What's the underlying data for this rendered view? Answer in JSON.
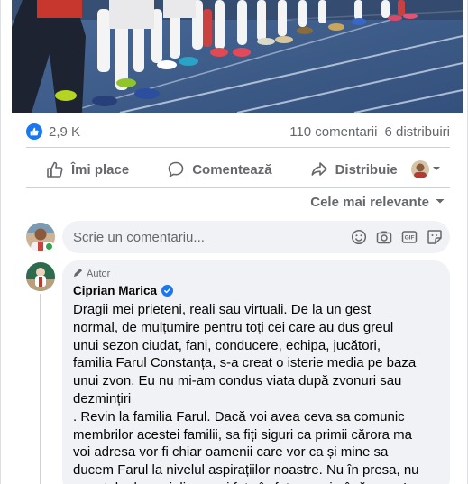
{
  "reactions": {
    "count": "2,9 K",
    "comments": "110 comentarii",
    "shares": "6 distribuiri"
  },
  "actions": {
    "like": "Îmi place",
    "comment": "Comentează",
    "share": "Distribuie"
  },
  "sort": {
    "label": "Cele mai relevante"
  },
  "composer": {
    "placeholder": "Scrie un comentariu..."
  },
  "comment": {
    "badge": "Autor",
    "author": "Ciprian Marica",
    "text": "Dragii mei prieteni, reali sau virtuali. De la un gest\nnormal, de mulțumire pentru toți cei care au dus greul\nunui sezon ciudat, fani, conducere, echipa, jucători,\nfamilia Farul Constanța, s-a creat o isterie media pe baza\nunui zvon. Eu nu mi-am condus viata după zvonuri sau\ndezmințiri\n. Revin la familia Farul. Dacă voi avea ceva sa comunic\nmembrilor acestei familii, sa fiți siguri ca primii cărora ma\nvoi adresa vor fi chiar oamenii care vor ca și mine sa\nducem Farul la nivelul aspirațiilor noastre. Nu în presa, nu\npe rețele de socializare, ci fata în fata, ca și până acum!"
  },
  "colors": {
    "accent": "#1877f2",
    "muted": "#65676b",
    "bubble": "#f0f2f5",
    "online": "#31a24c"
  },
  "icons": [
    "like-icon",
    "thumbs-up-icon",
    "comment-icon",
    "share-icon",
    "chevron-down-icon",
    "emoji-icon",
    "camera-icon",
    "gif-icon",
    "sticker-icon",
    "pencil-icon",
    "verified-icon"
  ]
}
